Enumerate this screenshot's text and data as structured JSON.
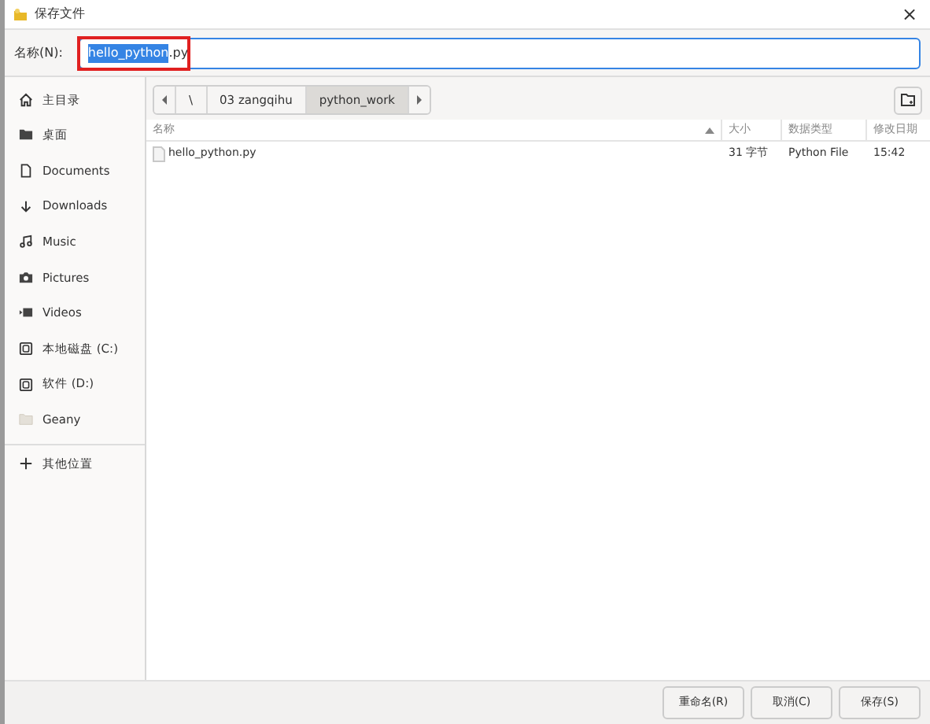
{
  "window": {
    "title": "保存文件",
    "close": "×"
  },
  "name_row": {
    "label": "名称(N):",
    "selected_part": "hello_python",
    "rest": ".py",
    "annotated": true
  },
  "sidebar": {
    "items": [
      {
        "label": "主目录"
      },
      {
        "label": "桌面"
      },
      {
        "label": "Documents"
      },
      {
        "label": "Downloads"
      },
      {
        "label": "Music"
      },
      {
        "label": "Pictures"
      },
      {
        "label": "Videos"
      },
      {
        "label": "本地磁盘 (C:)"
      },
      {
        "label": "软件 (D:)"
      },
      {
        "label": "Geany"
      }
    ],
    "other": {
      "label": "其他位置"
    }
  },
  "path_bar": {
    "crumbs": [
      {
        "label": "\\",
        "selected": false
      },
      {
        "label": "03 zangqihu",
        "selected": false
      },
      {
        "label": "python_work",
        "selected": true
      }
    ]
  },
  "table": {
    "columns": [
      {
        "label": "名称",
        "sorted": true
      },
      {
        "label": "大小",
        "sorted": false
      },
      {
        "label": "数据类型",
        "sorted": false
      },
      {
        "label": "修改日期",
        "sorted": false
      }
    ],
    "rows": [
      {
        "name": "hello_python.py",
        "size": "31 字节",
        "type": "Python File",
        "modified": "15:42"
      }
    ]
  },
  "buttons": [
    "重命名(R)",
    "取消(C)",
    "保存(S)"
  ]
}
